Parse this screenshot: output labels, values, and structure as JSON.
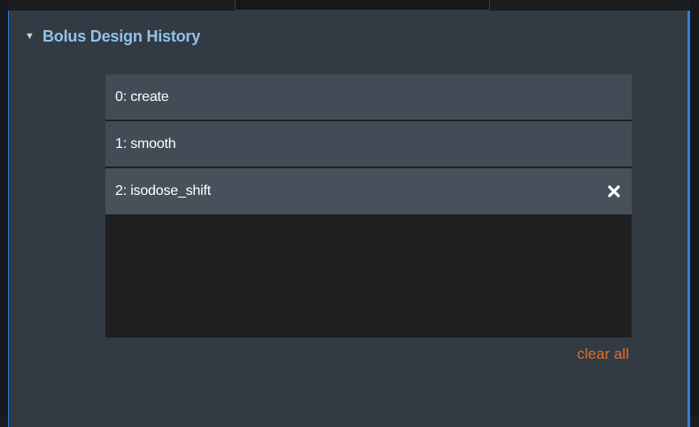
{
  "panel": {
    "section_title": "Bolus Design History",
    "expanded": true,
    "collapse_icon": "triangle-down-icon"
  },
  "history": {
    "items": [
      {
        "label": "0: create"
      },
      {
        "label": "1: smooth"
      },
      {
        "label": "2: isodose_shift",
        "removable": true,
        "remove_icon": "close-icon"
      }
    ],
    "clear_all_label": "clear all"
  },
  "colors": {
    "panel_bg": "#323a44",
    "item_bg": "#434c56",
    "list_bg": "#1f2022",
    "title": "#8fc3ea",
    "accent_border": "#2f7fd3",
    "clear_all": "#d9742a"
  }
}
